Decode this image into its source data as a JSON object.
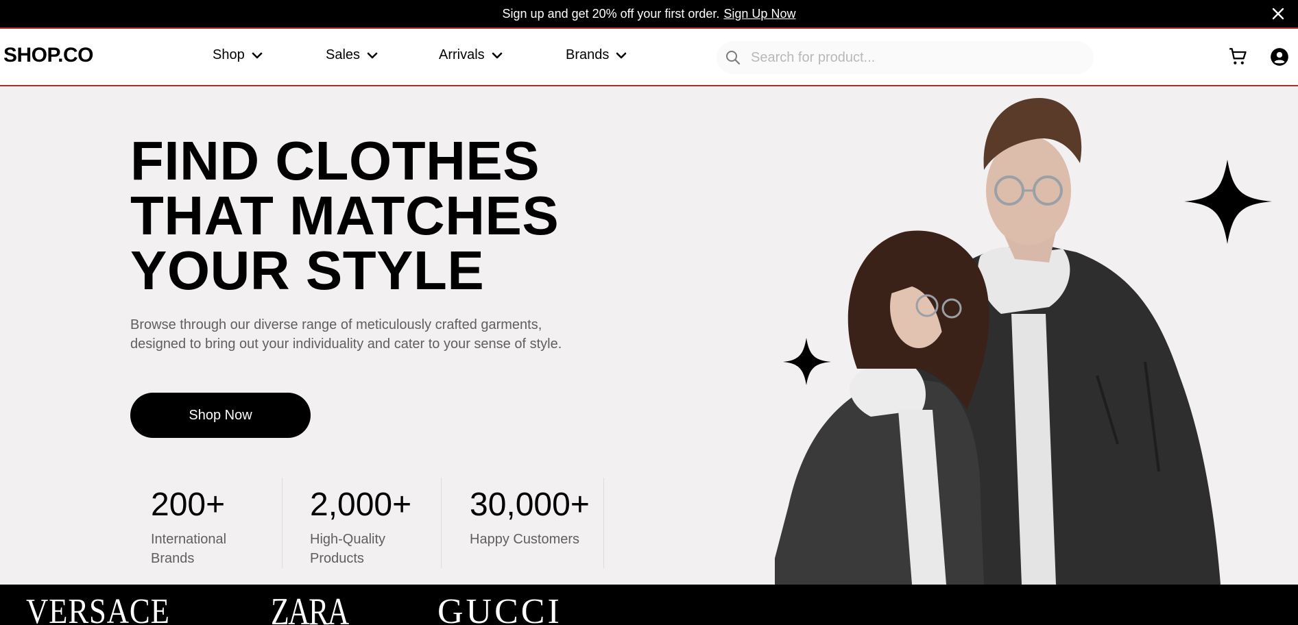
{
  "announcement": {
    "message": "Sign up and get 20% off your first order.",
    "link_label": "Sign Up Now",
    "close_icon": "close-icon"
  },
  "header": {
    "logo": "SHOP.CO",
    "nav": [
      {
        "label": "Shop",
        "icon": "chevron-down-icon"
      },
      {
        "label": "Sales",
        "icon": "chevron-down-icon"
      },
      {
        "label": "Arrivals",
        "icon": "chevron-down-icon"
      },
      {
        "label": "Brands",
        "icon": "chevron-down-icon"
      }
    ],
    "search": {
      "placeholder": "Search for product...",
      "value": "",
      "icon": "search-icon"
    },
    "cart_icon": "cart-icon",
    "account_icon": "account-icon"
  },
  "hero": {
    "title_lines": [
      "FIND CLOTHES",
      "THAT MATCHES",
      "YOUR STYLE"
    ],
    "subtitle_lines": [
      "Browse through our diverse range of meticulously crafted garments,",
      "designed to bring out your individuality and cater to your sense of style."
    ],
    "cta_label": "Shop Now",
    "stats": [
      {
        "value": "200+",
        "label_lines": [
          "International",
          "Brands"
        ]
      },
      {
        "value": "2,000+",
        "label_lines": [
          "High-Quality",
          "Products"
        ]
      },
      {
        "value": "30,000+",
        "label_lines": [
          "Happy Customers"
        ]
      }
    ]
  },
  "brands": [
    "VERSACE",
    "ZARA",
    "GUCCI"
  ],
  "colors": {
    "background": "#f2f0f1",
    "accent_border": "#b3272d",
    "primary": "#000000",
    "muted_text": "#5f5f5f"
  }
}
